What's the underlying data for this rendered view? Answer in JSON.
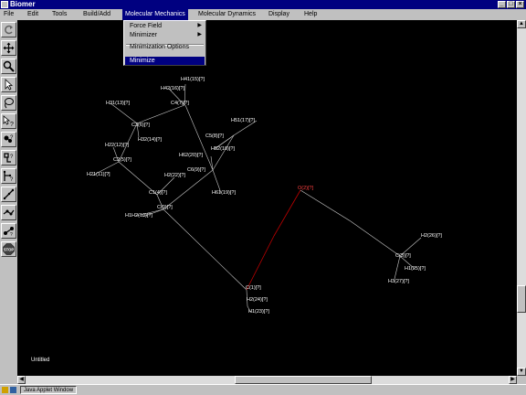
{
  "window": {
    "title": "Biomer"
  },
  "menu": {
    "items": [
      "File",
      "Edit",
      "Tools",
      "Build/Add",
      "Molecular Mechanics",
      "Molecular Dynamics",
      "Display",
      "Help"
    ],
    "active": "Molecular Mechanics"
  },
  "dropdown": {
    "force_field": "Force Field",
    "minimizer": "Minimizer",
    "minimization_options": "Minimization Options",
    "minimize": "Minimize"
  },
  "canvas": {
    "status": "Untitled"
  },
  "atoms": {
    "h41": "H41(15)[?]",
    "h42": "H42(16)[?]",
    "h31": "H31(13)[?]",
    "c4": "C4(7)[?]",
    "c3": "C3(6)[?]",
    "h32": "H32(14)[?]",
    "h51": "H51(17)[?]",
    "c5": "C5(8)[?]",
    "h22": "H22(12)[?]",
    "h62": "H62(20)[?]",
    "h52": "H52(18)[?]",
    "c2": "C2(5)[?]",
    "c6": "C6(9)[?]",
    "h21": "H21(11)[?]",
    "h2a": "H2(22)[?]",
    "h61": "H61(19)[?]",
    "c1": "C1(4)[?]",
    "o2": "O(2)[?]",
    "c0": "C(0)[?]",
    "h1h2": "H1H2(10)[?]",
    "h2b": "H2(26)[?]",
    "c3b": "C(3)[?]",
    "h1b": "H1(25)[?]",
    "h3": "H3(27)[?]",
    "c1b": "C(1)[?]",
    "h2c": "H2(24)[?]",
    "h1c": "H1(23)[?]"
  },
  "statusbar": {
    "applet": "Java Applet Window"
  },
  "colors": {
    "titlebar": "#000080",
    "canvas": "#000000",
    "bond": "#c8c8c8",
    "oxygen_bond": "#c00000"
  }
}
